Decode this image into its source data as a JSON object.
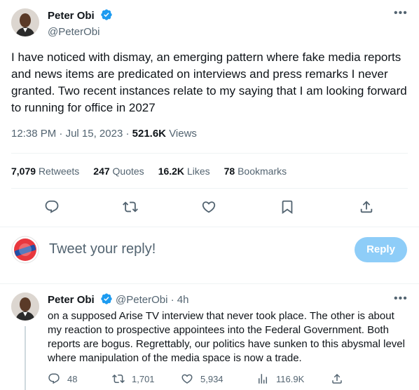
{
  "tweet": {
    "author_name": "Peter Obi",
    "author_handle": "@PeterObi",
    "text": "I have noticed with dismay, an emerging pattern where fake media reports and news items are predicated on interviews and press remarks I never granted. Two recent instances relate to my saying that I am looking forward to running for office in 2027",
    "time": "12:38 PM",
    "date": "Jul 15, 2023",
    "views_count": "521.6K",
    "views_label": "Views",
    "stats": {
      "retweets_count": "7,079",
      "retweets_label": "Retweets",
      "quotes_count": "247",
      "quotes_label": "Quotes",
      "likes_count": "16.2K",
      "likes_label": "Likes",
      "bookmarks_count": "78",
      "bookmarks_label": "Bookmarks"
    }
  },
  "reply_box": {
    "placeholder": "Tweet your reply!",
    "button_label": "Reply"
  },
  "reply": {
    "author_name": "Peter Obi",
    "author_handle": "@PeterObi",
    "time": "4h",
    "text": "on a supposed Arise TV interview that never took place. The other is about my reaction to prospective appointees into the Federal Government. Both reports are bogus. Regrettably, our politics have sunken to this abysmal level where manipulation of the media space is now a trade.",
    "replies": "48",
    "retweets": "1,701",
    "likes": "5,934",
    "views": "116.9K"
  },
  "icons": {
    "verified": "verified-badge-icon",
    "more": "more-icon",
    "reply": "reply-icon",
    "retweet": "retweet-icon",
    "like": "heart-icon",
    "bookmark": "bookmark-icon",
    "share": "share-icon",
    "views": "views-icon"
  },
  "colors": {
    "accent": "#1d9bf0",
    "reply_button_disabled": "#8ecdf8",
    "secondary_text": "#536471"
  }
}
